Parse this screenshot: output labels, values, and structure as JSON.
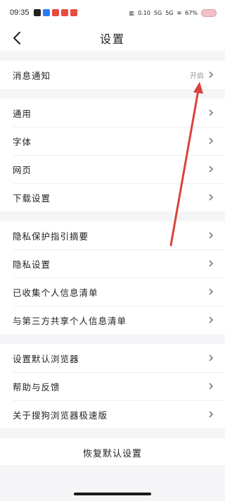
{
  "status_bar": {
    "time": "09:35",
    "network_speed": "0.10",
    "signal_label_1": "5G",
    "signal_label_2": "5G",
    "battery": "67%"
  },
  "header": {
    "title": "设置"
  },
  "sections": [
    {
      "items": [
        {
          "label": "消息通知",
          "value": "开启"
        }
      ]
    },
    {
      "items": [
        {
          "label": "通用"
        },
        {
          "label": "字体"
        },
        {
          "label": "网页"
        },
        {
          "label": "下载设置"
        }
      ]
    },
    {
      "items": [
        {
          "label": "隐私保护指引摘要"
        },
        {
          "label": "隐私设置"
        },
        {
          "label": "已收集个人信息清单"
        },
        {
          "label": "与第三方共享个人信息清单"
        }
      ]
    },
    {
      "items": [
        {
          "label": "设置默认浏览器"
        },
        {
          "label": "帮助与反馈"
        },
        {
          "label": "关于搜狗浏览器极速版"
        }
      ]
    }
  ],
  "restore_label": "恢复默认设置",
  "colors": {
    "arrow": "#d9433c",
    "divider_bg": "#f5f5f7"
  }
}
